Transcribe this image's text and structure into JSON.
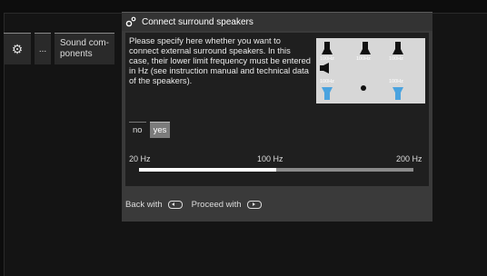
{
  "sidebar": {
    "gear_icon": "gear-icon",
    "dots_label": "...",
    "sound_components_line1": "Sound com-",
    "sound_components_line2": "ponents"
  },
  "dialog": {
    "title": "Connect surround speakers",
    "description": "Please specify here whether you want to connect external surround speakers. In this case, their lower limit frequency must be entered in Hz (see instruction manual and technical data of the speakers).",
    "toggle": {
      "no": "no",
      "yes": "yes",
      "selected": "yes"
    },
    "slider": {
      "min_label": "20 Hz",
      "mid_label": "100 Hz",
      "max_label": "200 Hz",
      "value_percent": 50
    },
    "speaker_diagram": {
      "top_left": "100Hz",
      "top_center": "100Hz",
      "top_right": "100Hz",
      "bottom_left": "100Hz",
      "bottom_right": "100Hz"
    },
    "footer": {
      "back": "Back with",
      "proceed": "Proceed with"
    }
  },
  "colors": {
    "accent_blue": "#4aa3df",
    "dialog_bg": "#3a3a3a",
    "panel_bg": "#1f1f1f"
  }
}
